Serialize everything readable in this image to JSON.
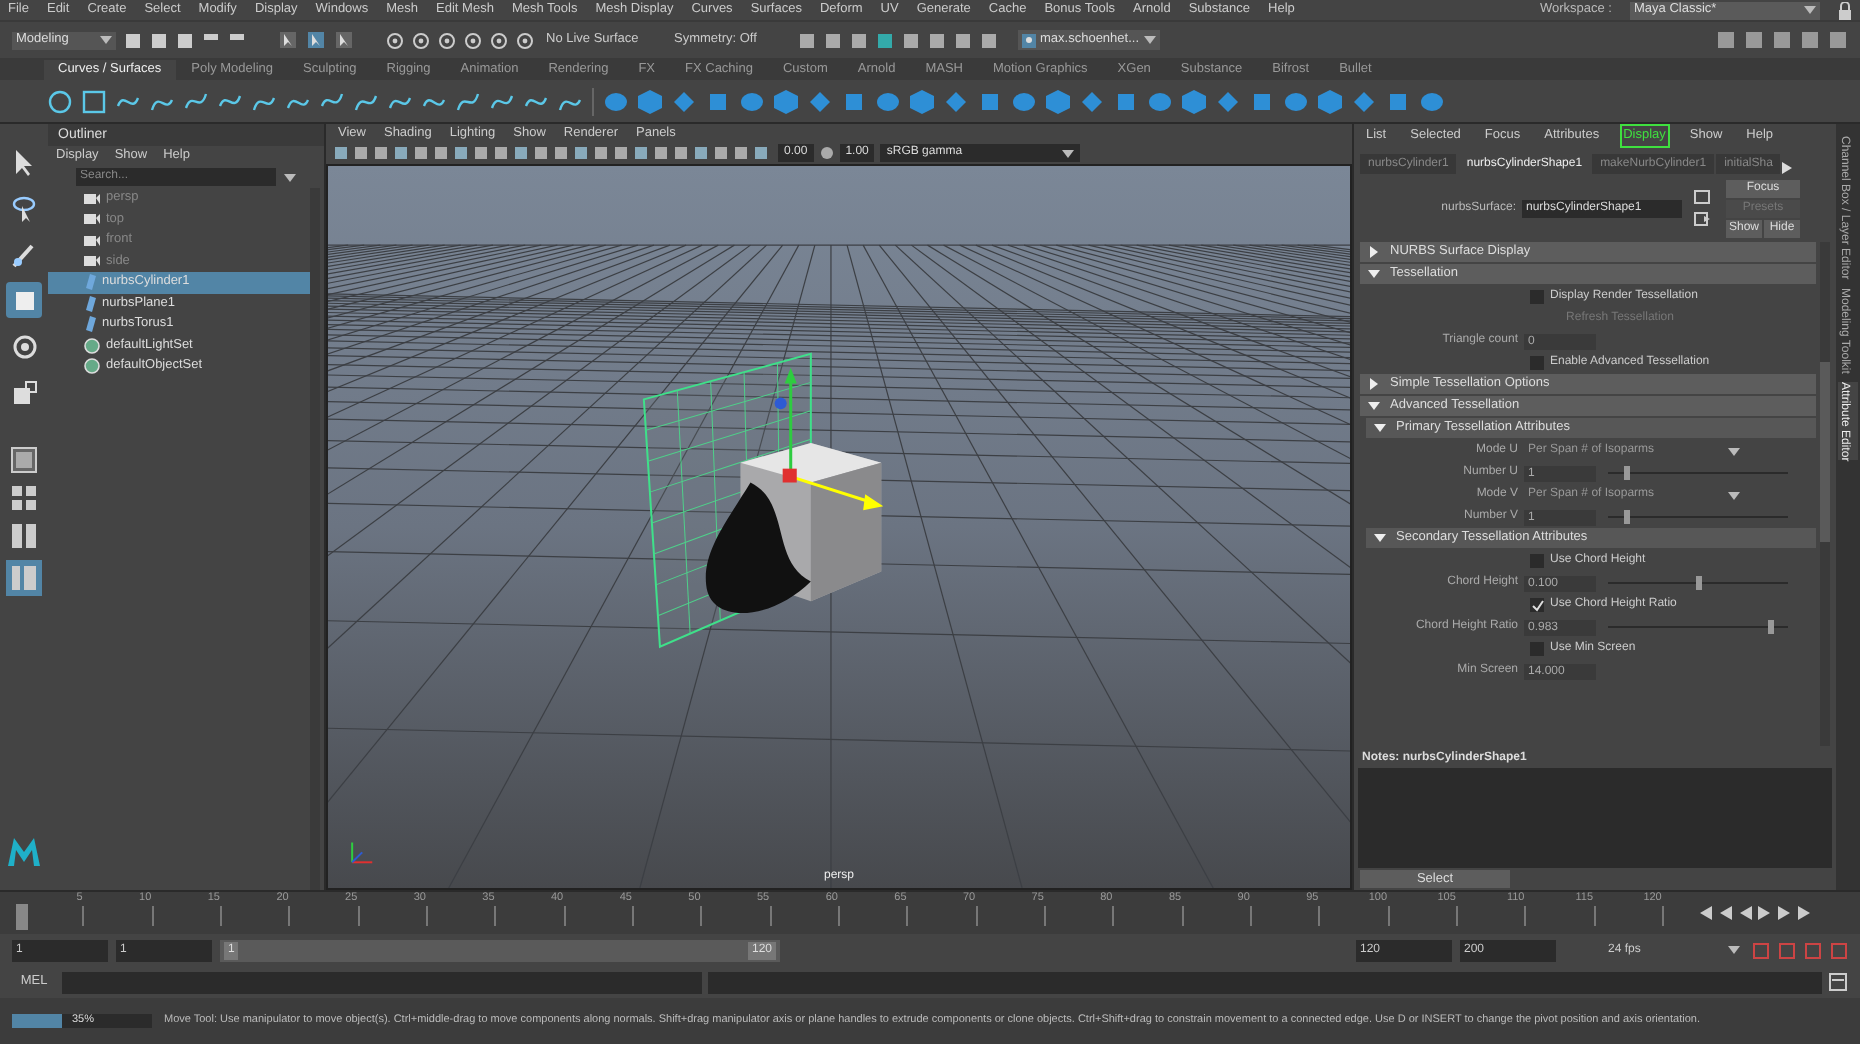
{
  "menu_bar": [
    "File",
    "Edit",
    "Create",
    "Select",
    "Modify",
    "Display",
    "Windows",
    "Mesh",
    "Edit Mesh",
    "Mesh Tools",
    "Mesh Display",
    "Curves",
    "Surfaces",
    "Deform",
    "UV",
    "Generate",
    "Cache",
    "Bonus Tools",
    "Arnold",
    "Substance",
    "Help"
  ],
  "status_line": {
    "mode": "Modeling",
    "live_surface": "No Live Surface",
    "symmetry": "Symmetry: Off",
    "user": "max.schoenhet...",
    "workspace_label": "Workspace :",
    "workspace": "Maya Classic*"
  },
  "shelf_tabs": [
    {
      "label": "Curves / Surfaces",
      "selected": true
    },
    {
      "label": "Poly Modeling",
      "selected": false
    },
    {
      "label": "Sculpting",
      "selected": false
    },
    {
      "label": "Rigging",
      "selected": false
    },
    {
      "label": "Animation",
      "selected": false
    },
    {
      "label": "Rendering",
      "selected": false
    },
    {
      "label": "FX",
      "selected": false
    },
    {
      "label": "FX Caching",
      "selected": false
    },
    {
      "label": "Custom",
      "selected": false
    },
    {
      "label": "Arnold",
      "selected": false
    },
    {
      "label": "MASH",
      "selected": false
    },
    {
      "label": "Motion Graphics",
      "selected": false
    },
    {
      "label": "XGen",
      "selected": false
    },
    {
      "label": "Substance",
      "selected": false
    },
    {
      "label": "Bifrost",
      "selected": false
    },
    {
      "label": "Bullet",
      "selected": false
    }
  ],
  "toolbox": [
    {
      "selected": false
    },
    {
      "selected": false
    },
    {
      "selected": false
    },
    {
      "selected": true
    },
    {
      "selected": false
    },
    {
      "selected": false
    }
  ],
  "outliner": {
    "title": "Outliner",
    "menus": [
      "Display",
      "Show",
      "Help"
    ],
    "search": {
      "placeholder": "Search..."
    },
    "items": [
      {
        "label": "persp",
        "kind": "camera",
        "dimmed": true,
        "selected": false
      },
      {
        "label": "top",
        "kind": "camera",
        "dimmed": true,
        "selected": false
      },
      {
        "label": "front",
        "kind": "camera",
        "dimmed": true,
        "selected": false
      },
      {
        "label": "side",
        "kind": "camera",
        "dimmed": true,
        "selected": false
      },
      {
        "label": "nurbsCylinder1",
        "kind": "surface",
        "dimmed": false,
        "selected": true
      },
      {
        "label": "nurbsPlane1",
        "kind": "surface",
        "dimmed": false,
        "selected": false
      },
      {
        "label": "nurbsTorus1",
        "kind": "surface",
        "dimmed": false,
        "selected": false
      },
      {
        "label": "defaultLightSet",
        "kind": "set",
        "dimmed": false,
        "selected": false
      },
      {
        "label": "defaultObjectSet",
        "kind": "set",
        "dimmed": false,
        "selected": false
      }
    ]
  },
  "viewport": {
    "menus": [
      "View",
      "Shading",
      "Lighting",
      "Show",
      "Renderer",
      "Panels"
    ],
    "exposure": "0.00",
    "gamma": "1.00",
    "color_space": "sRGB gamma",
    "camera_label": "persp"
  },
  "attribute_editor": {
    "menus": [
      {
        "label": "List",
        "highlighted": false
      },
      {
        "label": "Selected",
        "highlighted": false
      },
      {
        "label": "Focus",
        "highlighted": false
      },
      {
        "label": "Attributes",
        "highlighted": false
      },
      {
        "label": "Display",
        "highlighted": true
      },
      {
        "label": "Show",
        "highlighted": false
      },
      {
        "label": "Help",
        "highlighted": false
      }
    ],
    "tabs": [
      {
        "label": "nurbsCylinder1",
        "selected": false
      },
      {
        "label": "nurbsCylinderShape1",
        "selected": true
      },
      {
        "label": "makeNurbCylinder1",
        "selected": false
      },
      {
        "label": "initialSha",
        "selected": false
      }
    ],
    "node_label": "nurbsSurface:",
    "node_name": "nurbsCylinderShape1",
    "buttons": [
      {
        "label": "Focus",
        "disabled": false
      },
      {
        "label": "Presets",
        "disabled": true
      },
      {
        "label": "Show",
        "disabled": false
      },
      {
        "label": "Hide",
        "disabled": false
      }
    ],
    "sections": [
      {
        "kind": "section",
        "label": "NURBS Surface Display",
        "expanded": false
      },
      {
        "kind": "section",
        "label": "Tessellation",
        "expanded": true,
        "children": [
          {
            "kind": "checkbox",
            "label": "Display Render Tessellation",
            "checked": false
          },
          {
            "kind": "button",
            "label": "Refresh Tessellation",
            "disabled": true
          },
          {
            "kind": "field",
            "label": "Triangle count",
            "value": "0"
          },
          {
            "kind": "checkbox",
            "label": "Enable Advanced Tessellation",
            "checked": false
          }
        ]
      },
      {
        "kind": "section",
        "label": "Simple Tessellation Options",
        "expanded": false
      },
      {
        "kind": "section",
        "label": "Advanced Tessellation",
        "expanded": true,
        "children": [
          {
            "kind": "section",
            "label": "Primary Tessellation Attributes",
            "expanded": true,
            "children": [
              {
                "kind": "dropdown",
                "label": "Mode U",
                "value": "Per Span # of Isoparms"
              },
              {
                "kind": "slider",
                "label": "Number U",
                "value": "1",
                "level": 0.1
              },
              {
                "kind": "dropdown",
                "label": "Mode V",
                "value": "Per Span # of Isoparms"
              },
              {
                "kind": "slider",
                "label": "Number V",
                "value": "1",
                "level": 0.1
              }
            ]
          },
          {
            "kind": "section",
            "label": "Secondary Tessellation Attributes",
            "expanded": true,
            "children": [
              {
                "kind": "checkbox",
                "label": "Use Chord Height",
                "checked": false
              },
              {
                "kind": "slider",
                "label": "Chord Height",
                "value": "0.100",
                "level": 0.5
              },
              {
                "kind": "checkbox",
                "label": "Use Chord Height Ratio",
                "checked": true
              },
              {
                "kind": "slider",
                "label": "Chord Height Ratio",
                "value": "0.983",
                "level": 0.9
              },
              {
                "kind": "checkbox",
                "label": "Use Min Screen",
                "checked": false
              },
              {
                "kind": "field",
                "label": "Min Screen",
                "value": "14.000"
              }
            ]
          }
        ]
      }
    ],
    "notes_label": "Notes:  nurbsCylinderShape1",
    "select_button": "Select"
  },
  "side_tabs": [
    {
      "label": "Channel Box / Layer Editor",
      "selected": false
    },
    {
      "label": "Modeling Toolkit",
      "selected": false
    },
    {
      "label": "Attribute Editor",
      "selected": true
    }
  ],
  "time_slider": {
    "level": 0,
    "ticks": [
      "5",
      "10",
      "15",
      "20",
      "25",
      "30",
      "35",
      "40",
      "45",
      "50",
      "55",
      "60",
      "65",
      "70",
      "75",
      "80",
      "85",
      "90",
      "95",
      "100",
      "105",
      "110",
      "115",
      "120"
    ]
  },
  "range": {
    "start": "1",
    "playback_start": "1",
    "range_start": "1",
    "range_end": "120",
    "playback_end": "120",
    "end": "200",
    "fps": "24 fps",
    "level": 1
  },
  "command_line": {
    "language": "MEL"
  },
  "help_line": {
    "progress_label": "35%",
    "level": 0.35,
    "message": "Move Tool: Use manipulator to move object(s). Ctrl+middle-drag to move components along normals. Shift+drag manipulator axis or plane handles to extrude components or clone objects. Ctrl+Shift+drag to constrain movement to a connected edge. Use D or INSERT to change the pivot position and axis orientation."
  }
}
